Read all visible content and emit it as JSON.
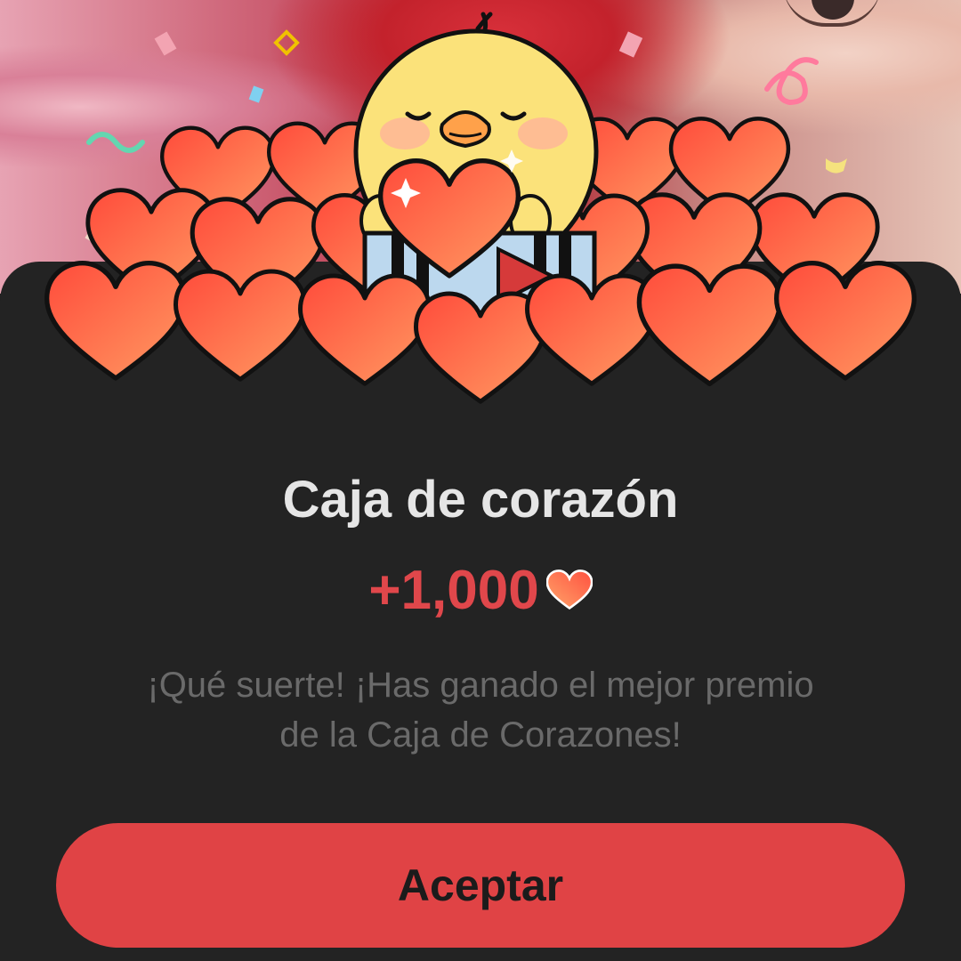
{
  "dialog": {
    "title": "Caja de corazón",
    "reward_amount": "+1,000",
    "reward_icon": "heart-icon",
    "message_line1": "¡Qué suerte! ¡Has ganado el mejor premio",
    "message_line2": "de la Caja de Corazones!",
    "accept_label": "Aceptar"
  },
  "colors": {
    "sheet_background": "#232323",
    "accent": "#e04345",
    "title_text": "#e6e6e6",
    "reward_text": "#e0474b",
    "message_text": "#6a6a6a"
  },
  "illustration": {
    "character": "chick-mascot",
    "items": [
      "hearts-pile",
      "gift-box",
      "confetti"
    ]
  }
}
